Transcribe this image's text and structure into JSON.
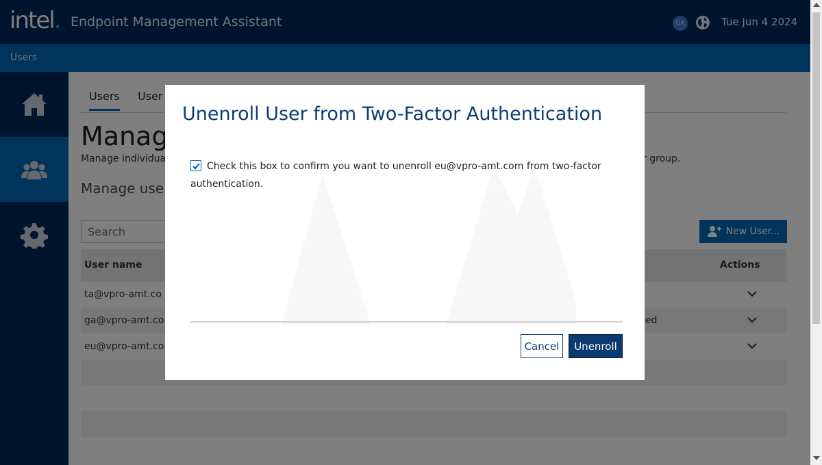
{
  "header": {
    "logo_text": "intel",
    "app_title": "Endpoint Management Assistant",
    "avatar_initials": "GA",
    "date": "Tue Jun 4 2024"
  },
  "subheader": {
    "label": "Users"
  },
  "sidebar": {
    "items": [
      {
        "icon": "home-icon",
        "active": false
      },
      {
        "icon": "users-icon",
        "active": true
      },
      {
        "icon": "gear-icon",
        "active": false
      }
    ]
  },
  "main": {
    "tabs": [
      {
        "label": "Users",
        "active": true
      },
      {
        "label": "User"
      }
    ],
    "page_title": "Manag",
    "description_start": "Manage individua",
    "description_end": "r group.",
    "section_title": "Manage user",
    "search_placeholder": "Search",
    "new_user_label": "New User...",
    "table": {
      "headers": [
        "User name",
        "Actions"
      ],
      "rows": [
        {
          "name": "ta@vpro-amt.co",
          "status": ""
        },
        {
          "name": "ga@vpro-amt.co",
          "status": "led"
        },
        {
          "name": "eu@vpro-amt.co",
          "status": ""
        }
      ]
    }
  },
  "modal": {
    "title": "Unenroll User from Two-Factor Authentication",
    "confirm_text": "Check this box to confirm you want to unenroll eu@vpro-amt.com from two-factor authentication.",
    "checkbox_checked": true,
    "cancel_label": "Cancel",
    "unenroll_label": "Unenroll"
  },
  "colors": {
    "header_bg": "#00285a",
    "accent": "#0068b5",
    "modal_title": "#0a3d75"
  }
}
